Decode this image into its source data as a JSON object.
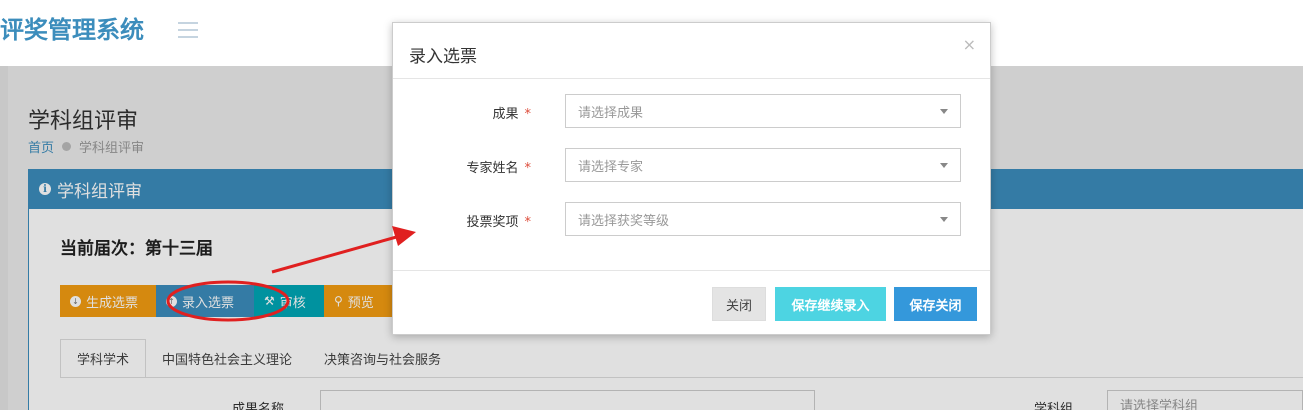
{
  "header": {
    "app_title": "评奖管理系统"
  },
  "page": {
    "title": "学科组评审",
    "breadcrumb": {
      "home": "首页",
      "current": "学科组评审"
    },
    "box_title": "学科组评审",
    "current_session": "当前届次：第十三届"
  },
  "toolbar": {
    "generate_label": "生成选票",
    "entry_label": "录入选票",
    "audit_label": "审核",
    "preview_label": "预览"
  },
  "tabs": [
    {
      "label": "学科学术"
    },
    {
      "label": "中国特色社会主义理论"
    },
    {
      "label": "决策咨询与社会服务"
    }
  ],
  "filters": {
    "result_name_label": "成果名称",
    "subject_group_label": "学科组",
    "subject_group_placeholder": "请选择学科组"
  },
  "modal": {
    "title": "录入选票",
    "close_symbol": "×",
    "fields": [
      {
        "label": "成果",
        "placeholder": "请选择成果"
      },
      {
        "label": "专家姓名",
        "placeholder": "请选择专家"
      },
      {
        "label": "投票奖项",
        "placeholder": "请选择获奖等级"
      }
    ],
    "required_mark": "*",
    "buttons": {
      "close": "关闭",
      "save_continue": "保存继续录入",
      "save_close": "保存关闭"
    }
  },
  "colors": {
    "primary": "#3c8dbc",
    "warning": "#f39c12",
    "teal": "#00a7b5",
    "annotation_red": "#e02020"
  },
  "icons": {
    "menu": "hamburger-icon",
    "info": "info-icon",
    "generate": "download-circle-icon",
    "entry": "upload-circle-icon",
    "audit": "gavel-icon",
    "preview": "search-icon",
    "dropdown": "caret-down-icon"
  }
}
